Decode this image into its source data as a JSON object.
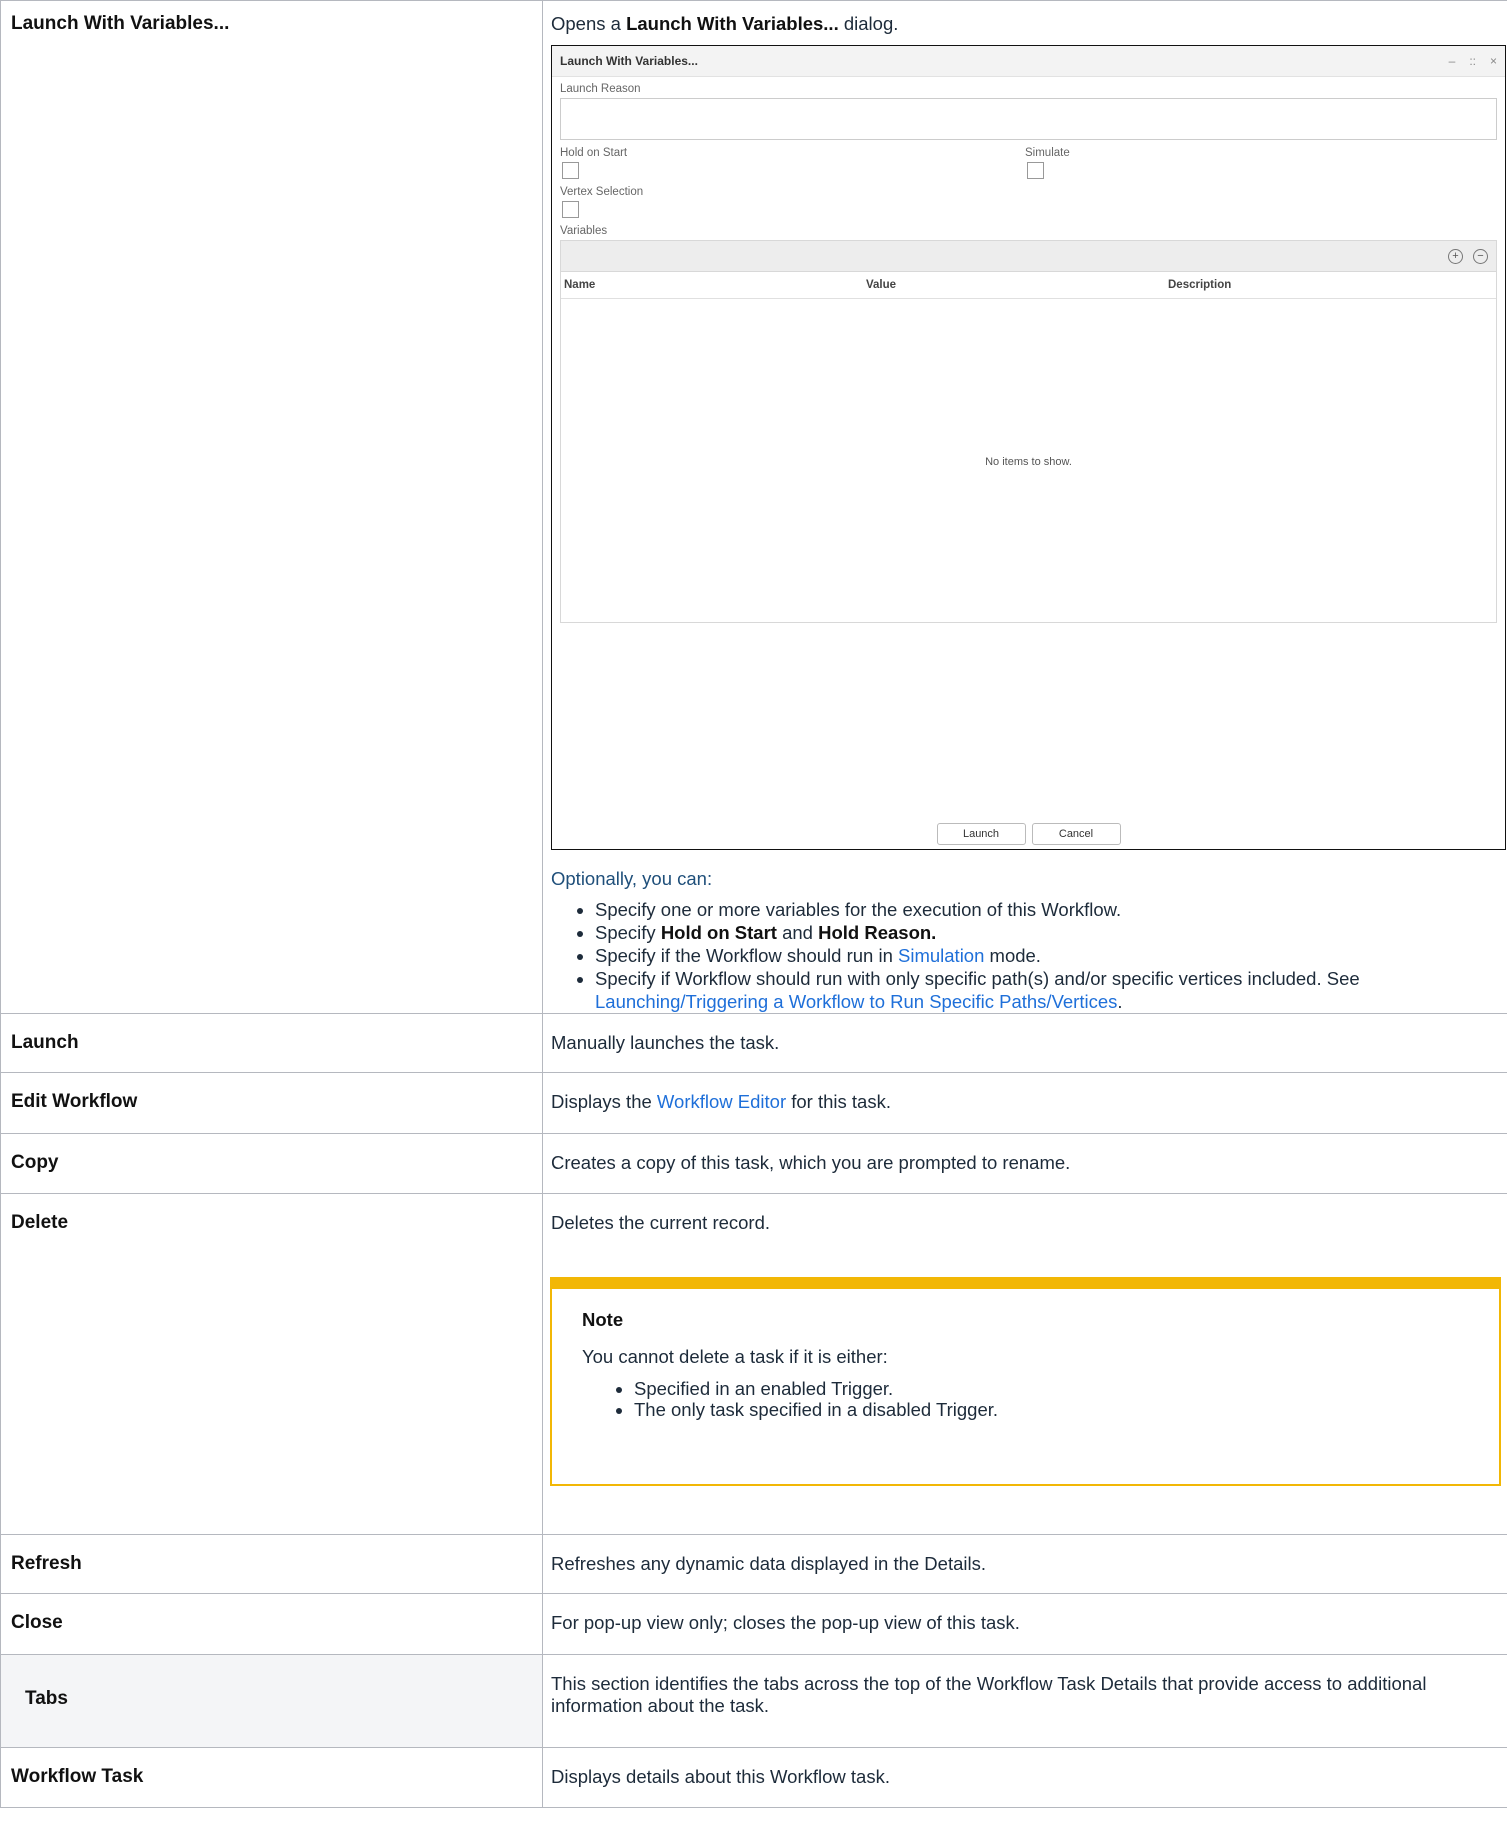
{
  "rows": {
    "launch_vars": {
      "label": "Launch With Variables...",
      "desc_prefix": "Opens a ",
      "desc_bold": "Launch With Variables...",
      "desc_suffix": " dialog.",
      "dialog": {
        "title": "Launch With Variables...",
        "controls": [
          "–",
          "::",
          "×"
        ],
        "launch_reason_label": "Launch Reason",
        "hold_on_start_label": "Hold on Start",
        "simulate_label": "Simulate",
        "vertex_selection_label": "Vertex Selection",
        "variables_label": "Variables",
        "add_icon": "plus-circle-icon",
        "remove_icon": "minus-circle-icon",
        "add_glyph": "+",
        "remove_glyph": "−",
        "columns": [
          "Name",
          "Value",
          "Description"
        ],
        "empty_message": "No items to show.",
        "launch_button": "Launch",
        "cancel_button": "Cancel"
      },
      "optionally": "Optionally, you can:",
      "bullets": {
        "b1": "Specify one or more variables for the execution of this Workflow.",
        "b2_pre": "Specify ",
        "b2_bold1": "Hold on Start",
        "b2_mid": " and ",
        "b2_bold2": "Hold Reason.",
        "b3_pre": "Specify if the Workflow should run in ",
        "b3_link": "Simulation",
        "b3_post": " mode.",
        "b4_pre": "Specify if Workflow should run with only specific path(s) and/or specific vertices included. See ",
        "b4_link": "Launching/Triggering a Workflow to Run Specific Paths/Vertices",
        "b4_post": "."
      }
    },
    "launch": {
      "label": "Launch",
      "desc": "Manually launches the task."
    },
    "edit_workflow": {
      "label": "Edit Workflow",
      "desc_pre": "Displays the ",
      "desc_link": "Workflow Editor",
      "desc_post": " for this task."
    },
    "copy": {
      "label": "Copy",
      "desc": "Creates a copy of this task, which you are prompted to rename."
    },
    "delete": {
      "label": "Delete",
      "desc": "Deletes the current record.",
      "note_title": "Note",
      "note_text": "You cannot delete a task if it is either:",
      "note_items": [
        "Specified in an enabled Trigger.",
        "The only task specified in a disabled Trigger."
      ]
    },
    "refresh": {
      "label": "Refresh",
      "desc": "Refreshes any dynamic data displayed in the Details."
    },
    "close": {
      "label": "Close",
      "desc": "For pop-up view only; closes the pop-up view of this task."
    },
    "tabs": {
      "label": "Tabs",
      "desc": "This section identifies the tabs across the top of the Workflow Task Details that provide access to additional information about the task."
    },
    "workflow_task": {
      "label": "Workflow Task",
      "desc": "Displays details about this Workflow task."
    }
  },
  "colors": {
    "link": "#1e6fd9",
    "note_border": "#f2b705",
    "text": "#1d2b3a"
  }
}
